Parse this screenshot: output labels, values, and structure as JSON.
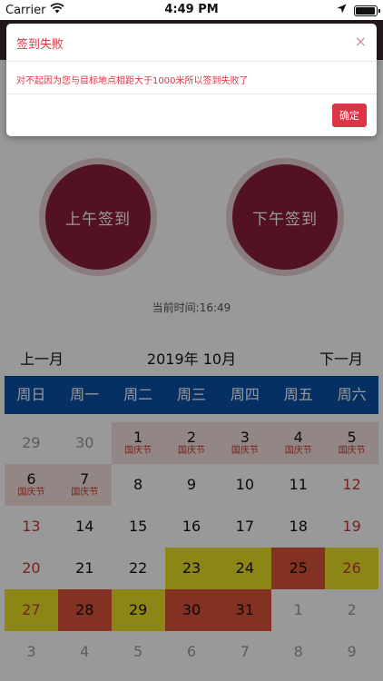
{
  "status_bar": {
    "carrier": "Carrier",
    "time": "4:49 PM",
    "battery_level": 1.0,
    "icons": [
      "wifi-icon",
      "location-arrow-icon",
      "battery-icon"
    ]
  },
  "sign_buttons": {
    "morning": "上午签到",
    "afternoon": "下午签到"
  },
  "current_time": "当前时间:16:49",
  "calendar": {
    "prev_label": "上一月",
    "title": "2019年 10月",
    "next_label": "下一月",
    "weekdays": [
      "周日",
      "周一",
      "周二",
      "周三",
      "周四",
      "周五",
      "周六"
    ],
    "days": [
      {
        "n": "29",
        "other": true
      },
      {
        "n": "30",
        "other": true
      },
      {
        "n": "1",
        "note": "国庆节",
        "holiday": true
      },
      {
        "n": "2",
        "note": "国庆节",
        "holiday": true
      },
      {
        "n": "3",
        "note": "国庆节",
        "holiday": true
      },
      {
        "n": "4",
        "note": "国庆节",
        "holiday": true
      },
      {
        "n": "5",
        "note": "国庆节",
        "holiday": true
      },
      {
        "n": "6",
        "note": "国庆节",
        "holiday": true
      },
      {
        "n": "7",
        "note": "国庆节",
        "holiday": true
      },
      {
        "n": "8"
      },
      {
        "n": "9"
      },
      {
        "n": "10"
      },
      {
        "n": "11"
      },
      {
        "n": "12",
        "weekend": true
      },
      {
        "n": "13",
        "weekend": true
      },
      {
        "n": "14"
      },
      {
        "n": "15"
      },
      {
        "n": "16"
      },
      {
        "n": "17"
      },
      {
        "n": "18"
      },
      {
        "n": "19",
        "weekend": true
      },
      {
        "n": "20",
        "weekend": true
      },
      {
        "n": "21"
      },
      {
        "n": "22"
      },
      {
        "n": "23",
        "status": "yellow"
      },
      {
        "n": "24",
        "status": "yellow"
      },
      {
        "n": "25",
        "status": "red"
      },
      {
        "n": "26",
        "weekend": true,
        "status": "yellow"
      },
      {
        "n": "27",
        "weekend": true,
        "status": "yellow"
      },
      {
        "n": "28",
        "status": "red"
      },
      {
        "n": "29",
        "status": "yellow"
      },
      {
        "n": "30",
        "status": "red"
      },
      {
        "n": "31",
        "status": "red"
      },
      {
        "n": "1",
        "other": true
      },
      {
        "n": "2",
        "other": true
      },
      {
        "n": "3",
        "other": true
      },
      {
        "n": "4",
        "other": true
      },
      {
        "n": "5",
        "other": true
      },
      {
        "n": "6",
        "other": true
      },
      {
        "n": "7",
        "other": true
      },
      {
        "n": "8",
        "other": true
      },
      {
        "n": "9",
        "other": true
      }
    ]
  },
  "modal": {
    "title": "签到失败",
    "close_symbol": "×",
    "message": "对不起因为您与目标地点相距大于1000米所以签到失败了",
    "ok_label": "确定"
  },
  "colors": {
    "accent_red": "#dc3545",
    "sign_button": "#8a1e37",
    "week_header": "#0a4fa6",
    "status_yellow": "#e8e023",
    "status_red": "#d9533a",
    "holiday_bg": "#f6e1de"
  }
}
